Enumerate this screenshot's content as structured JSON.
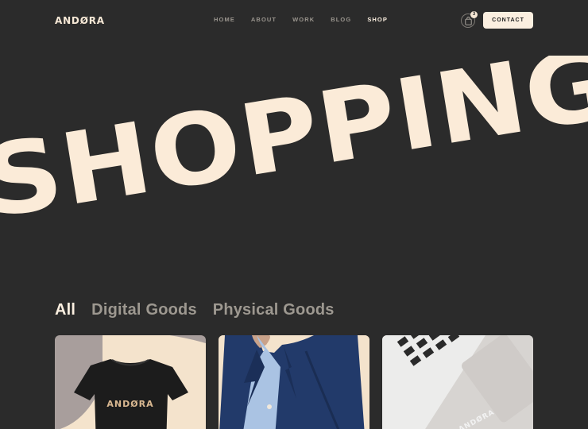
{
  "header": {
    "logo": "ANDØRA",
    "nav": [
      "HOME",
      "ABOUT",
      "WORK",
      "BLOG",
      "SHOP"
    ],
    "active_nav": "SHOP",
    "cart_count": "3",
    "contact_label": "CONTACT"
  },
  "hero": {
    "text": "SHOPPING"
  },
  "filters": {
    "items": [
      "All",
      "Digital Goods",
      "Physical Goods"
    ],
    "active": "All"
  },
  "products": [
    {
      "print": "ANDØRA",
      "image": "black-tshirt"
    },
    {
      "image": "man-in-navy-blazer"
    },
    {
      "print": "ANDØRA",
      "image": "laptop"
    }
  ],
  "colors": {
    "background": "#2b2b2b",
    "cream": "#fbebd8",
    "nav_muted": "#9a958e",
    "filter_muted": "#9d9890"
  }
}
